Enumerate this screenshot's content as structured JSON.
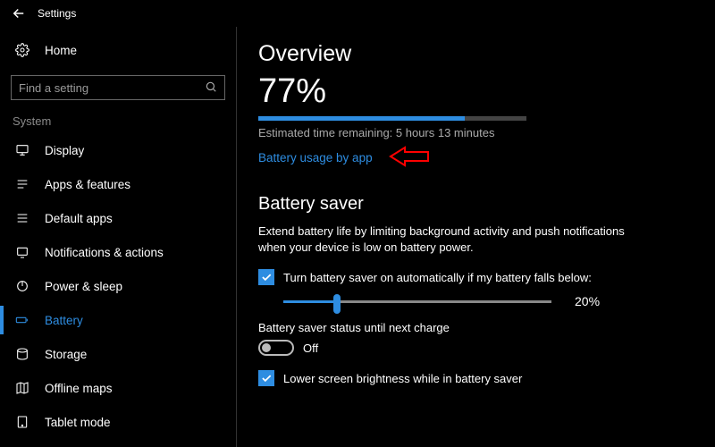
{
  "window": {
    "title": "Settings"
  },
  "sidebar": {
    "home": "Home",
    "search_placeholder": "Find a setting",
    "group": "System",
    "items": [
      {
        "label": "Display"
      },
      {
        "label": "Apps & features"
      },
      {
        "label": "Default apps"
      },
      {
        "label": "Notifications & actions"
      },
      {
        "label": "Power & sleep"
      },
      {
        "label": "Battery"
      },
      {
        "label": "Storage"
      },
      {
        "label": "Offline maps"
      },
      {
        "label": "Tablet mode"
      }
    ],
    "selected_index": 5
  },
  "overview": {
    "heading": "Overview",
    "percent_text": "77%",
    "percent_value": 77,
    "estimated": "Estimated time remaining: 5 hours 13 minutes",
    "usage_link": "Battery usage by app"
  },
  "saver": {
    "heading": "Battery saver",
    "description": "Extend battery life by limiting background activity and push notifications when your device is low on battery power.",
    "auto_checkbox_label": "Turn battery saver on automatically if my battery falls below:",
    "auto_checked": true,
    "threshold_value": 20,
    "threshold_text": "20%",
    "status_label": "Battery saver status until next charge",
    "toggle_on": false,
    "toggle_text": "Off",
    "brightness_label": "Lower screen brightness while in battery saver",
    "brightness_checked": true
  },
  "colors": {
    "accent": "#2e8de1",
    "annotation": "#ff0000"
  }
}
